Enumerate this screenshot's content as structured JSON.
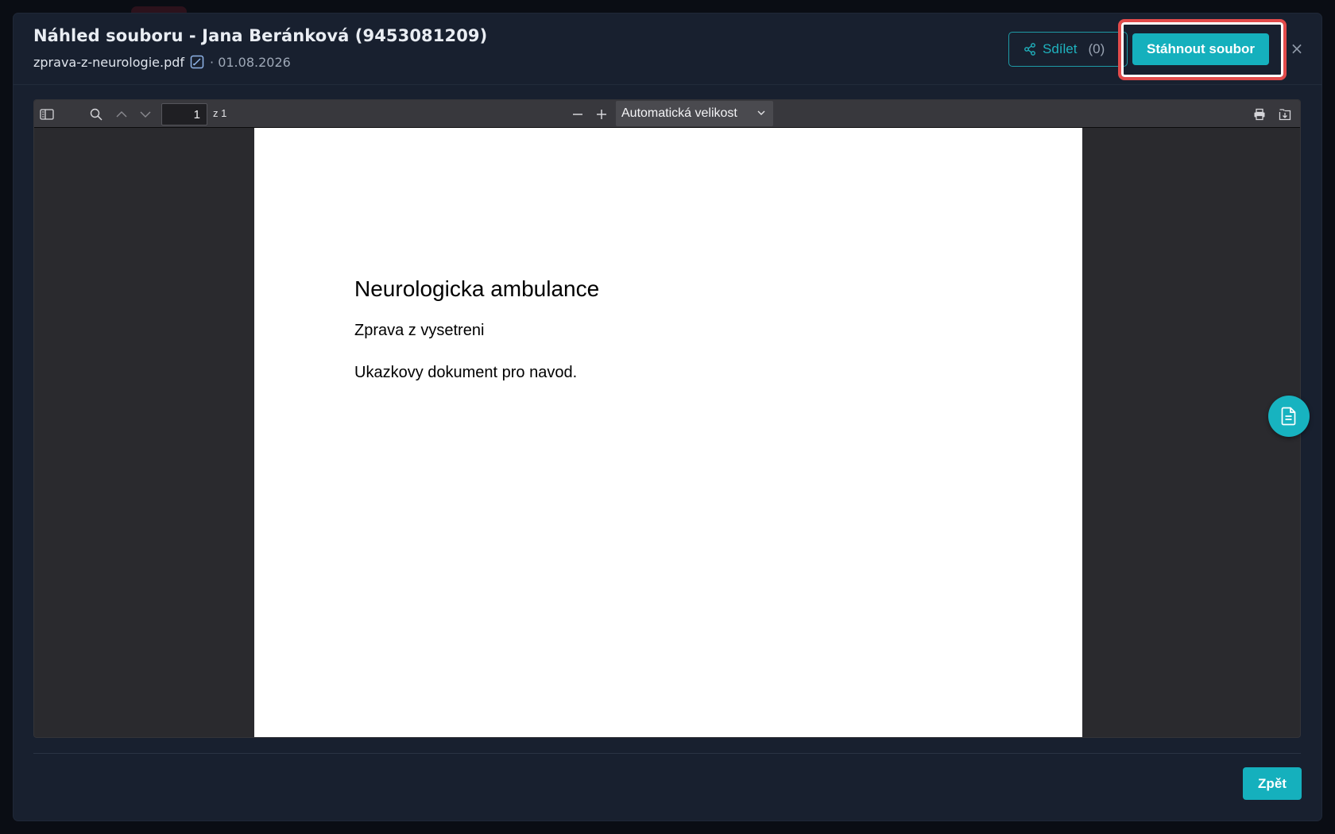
{
  "colors": {
    "accent": "#15b0bd",
    "highlight": "#e24b4b",
    "modal_bg": "#18202f"
  },
  "header": {
    "title": "Náhled souboru - Jana Beránková (9453081209)",
    "file_name": "zprava-z-neurologie.pdf",
    "date": "· 01.08.2026",
    "share_label": "Sdílet",
    "share_count": "(0)",
    "download_label": "Stáhnout soubor",
    "close_label": "×"
  },
  "icons": {
    "edit": "edit-icon",
    "share": "share-icon",
    "close": "close-icon",
    "sidebar_toggle": "sidebar-toggle-icon",
    "search": "search-icon",
    "prev_page": "chevron-up-icon",
    "next_page": "chevron-down-icon",
    "zoom_out": "minus-icon",
    "zoom_in": "plus-icon",
    "print": "print-icon",
    "save": "download-icon",
    "fab": "document-icon"
  },
  "viewer": {
    "page_number": "1",
    "page_total": "z 1",
    "zoom_value": "Automatická velikost"
  },
  "document": {
    "heading": "Neurologicka ambulance",
    "line1": "Zprava z vysetreni",
    "line2": "Ukazkovy dokument pro navod."
  },
  "footer": {
    "back_label": "Zpět"
  }
}
